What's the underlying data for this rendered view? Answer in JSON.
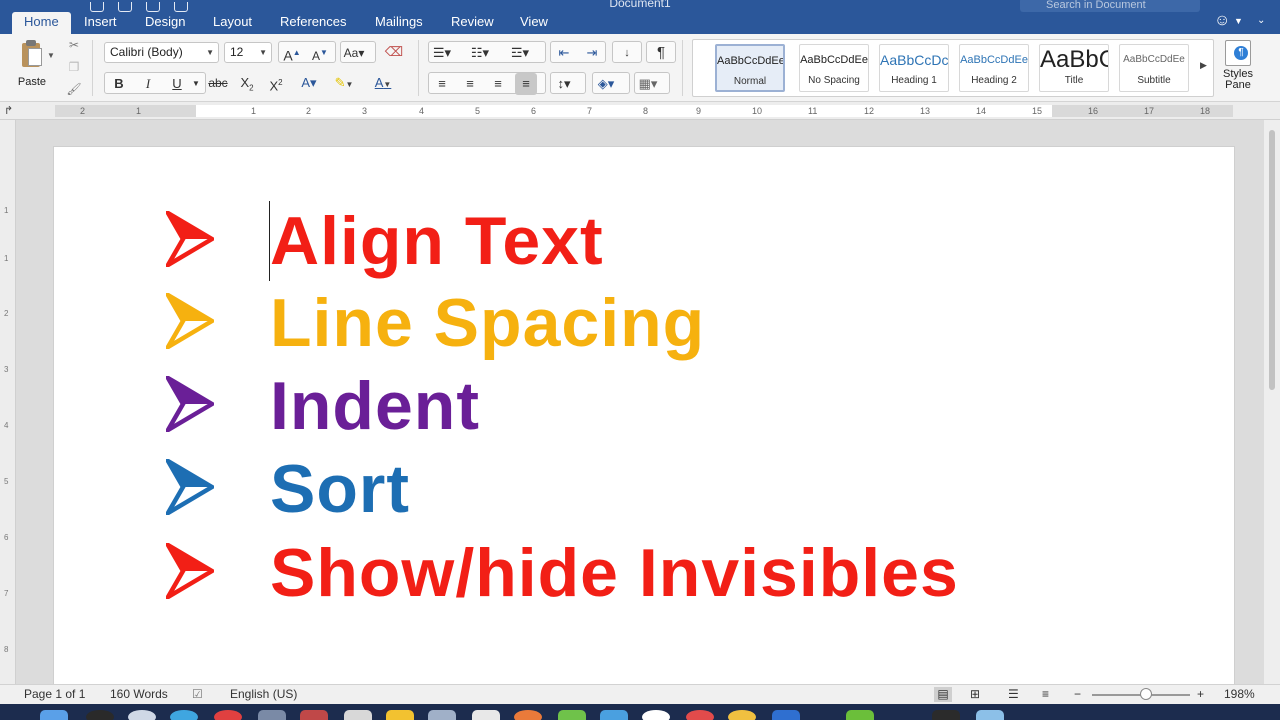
{
  "window": {
    "title": "Document1",
    "search_placeholder": "Search in Document"
  },
  "tabs": [
    "Home",
    "Insert",
    "Design",
    "Layout",
    "References",
    "Mailings",
    "Review",
    "View"
  ],
  "ribbon": {
    "paste_label": "Paste",
    "font_name": "Calibri (Body)",
    "font_size": "12",
    "styles": [
      {
        "sample": "AaBbCcDdEe",
        "name": "Normal"
      },
      {
        "sample": "AaBbCcDdEe",
        "name": "No Spacing"
      },
      {
        "sample": "AaBbCcDc",
        "name": "Heading 1"
      },
      {
        "sample": "AaBbCcDdEe",
        "name": "Heading 2"
      },
      {
        "sample": "AaBbC",
        "name": "Title"
      },
      {
        "sample": "AaBbCcDdEe",
        "name": "Subtitle"
      }
    ],
    "styles_pane_label": "Styles Pane",
    "selected_style": "Normal"
  },
  "ruler": {
    "numbers": [
      "2",
      "1",
      "1",
      "2",
      "3",
      "4",
      "5",
      "6",
      "7",
      "8",
      "9",
      "10",
      "11",
      "12",
      "13",
      "14",
      "15",
      "16",
      "17",
      "18"
    ]
  },
  "vruler": {
    "numbers": [
      "1",
      "1",
      "2",
      "3",
      "4",
      "5",
      "6",
      "7",
      "8"
    ]
  },
  "document": {
    "bullets": [
      {
        "text": "Align Text",
        "color": "#f21f16"
      },
      {
        "text": "Line Spacing",
        "color": "#f6b10f"
      },
      {
        "text": "Indent",
        "color": "#6a1f97"
      },
      {
        "text": "Sort",
        "color": "#1d6eb3"
      },
      {
        "text": "Show/hide Invisibles",
        "color": "#f21f16"
      }
    ]
  },
  "status": {
    "page": "Page 1 of 1",
    "words": "160 Words",
    "language": "English (US)",
    "zoom": "198%",
    "zoom_level": 0.55
  }
}
